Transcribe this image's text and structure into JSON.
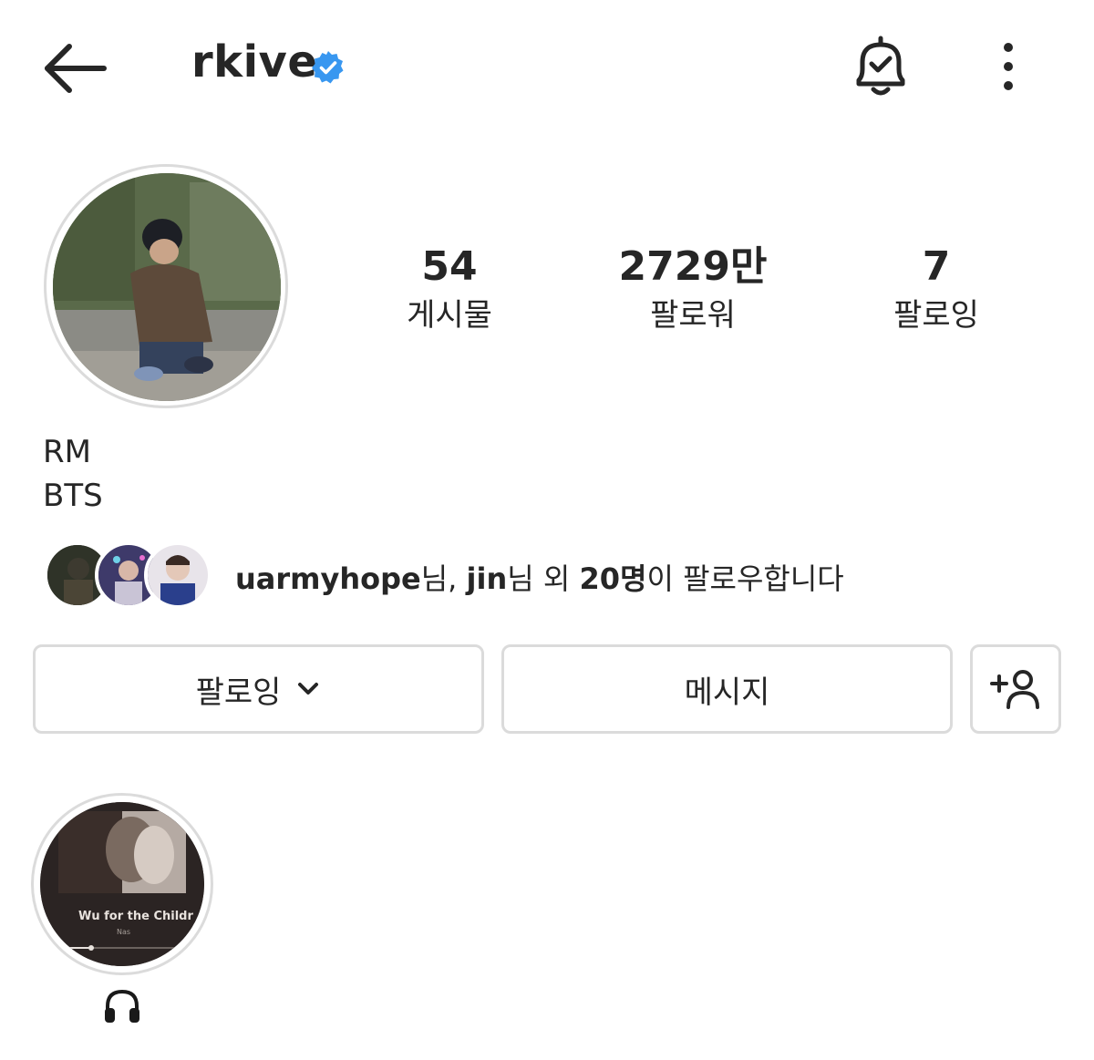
{
  "header": {
    "username": "rkive",
    "icons": {
      "back": "arrow-left-icon",
      "verified": "verified-badge-icon",
      "bell": "bell-check-icon",
      "more": "more-vertical-icon"
    }
  },
  "profile": {
    "stats": [
      {
        "value": "54",
        "label": "게시물"
      },
      {
        "value": "2729만",
        "label": "팔로워"
      },
      {
        "value": "7",
        "label": "팔로잉"
      }
    ],
    "bio_name": "RM",
    "bio_text": "BTS"
  },
  "followed_by": {
    "user1": "uarmyhope",
    "suffix1": "님, ",
    "user2": "jin",
    "suffix2": "님 외 ",
    "count": "20명",
    "suffix3": "이 팔로우합니다"
  },
  "actions": {
    "following_label": "팔로잉",
    "message_label": "메시지",
    "icons": {
      "chevron": "chevron-down-icon",
      "add_person": "add-person-icon"
    }
  },
  "highlight": {
    "cover_title": "Wu for the Childr",
    "cover_artist": "Nas",
    "icon": "headphones-icon"
  },
  "colors": {
    "verified_blue": "#3897f0",
    "text": "#262626",
    "border": "#dbdbdb"
  }
}
